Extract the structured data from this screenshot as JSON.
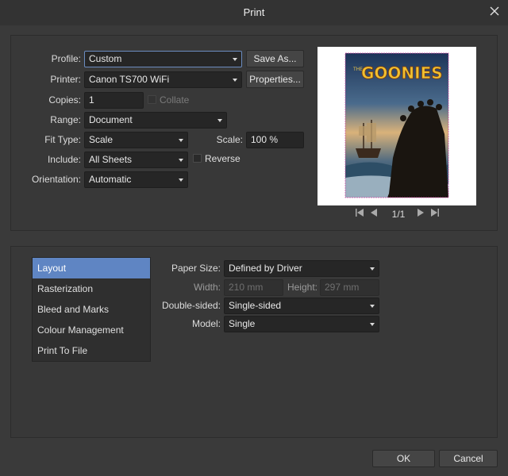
{
  "window": {
    "title": "Print"
  },
  "top": {
    "profile_label": "Profile:",
    "profile_value": "Custom",
    "save_as": "Save As...",
    "printer_label": "Printer:",
    "printer_value": "Canon TS700 WiFi",
    "properties": "Properties...",
    "copies_label": "Copies:",
    "copies_value": "1",
    "collate": "Collate",
    "range_label": "Range:",
    "range_value": "Document",
    "fit_label": "Fit Type:",
    "fit_value": "Scale",
    "scale_label": "Scale:",
    "scale_value": "100 %",
    "include_label": "Include:",
    "include_value": "All Sheets",
    "reverse": "Reverse",
    "orientation_label": "Orientation:",
    "orientation_value": "Automatic"
  },
  "preview": {
    "page_indicator": "1/1",
    "poster_title": "GOONIES",
    "poster_prefix": "THE"
  },
  "sidebar": {
    "items": [
      {
        "label": "Layout",
        "selected": true
      },
      {
        "label": "Rasterization",
        "selected": false
      },
      {
        "label": "Bleed and Marks",
        "selected": false
      },
      {
        "label": "Colour Management",
        "selected": false
      },
      {
        "label": "Print To File",
        "selected": false
      }
    ]
  },
  "layout": {
    "paper_size_label": "Paper Size:",
    "paper_size_value": "Defined by Driver",
    "width_label": "Width:",
    "width_value": "210 mm",
    "height_label": "Height:",
    "height_value": "297 mm",
    "double_sided_label": "Double-sided:",
    "double_sided_value": "Single-sided",
    "model_label": "Model:",
    "model_value": "Single"
  },
  "footer": {
    "ok": "OK",
    "cancel": "Cancel"
  },
  "colors": {
    "accent": "#5f85c3",
    "background": "#3a3a3a",
    "field": "#262626"
  }
}
